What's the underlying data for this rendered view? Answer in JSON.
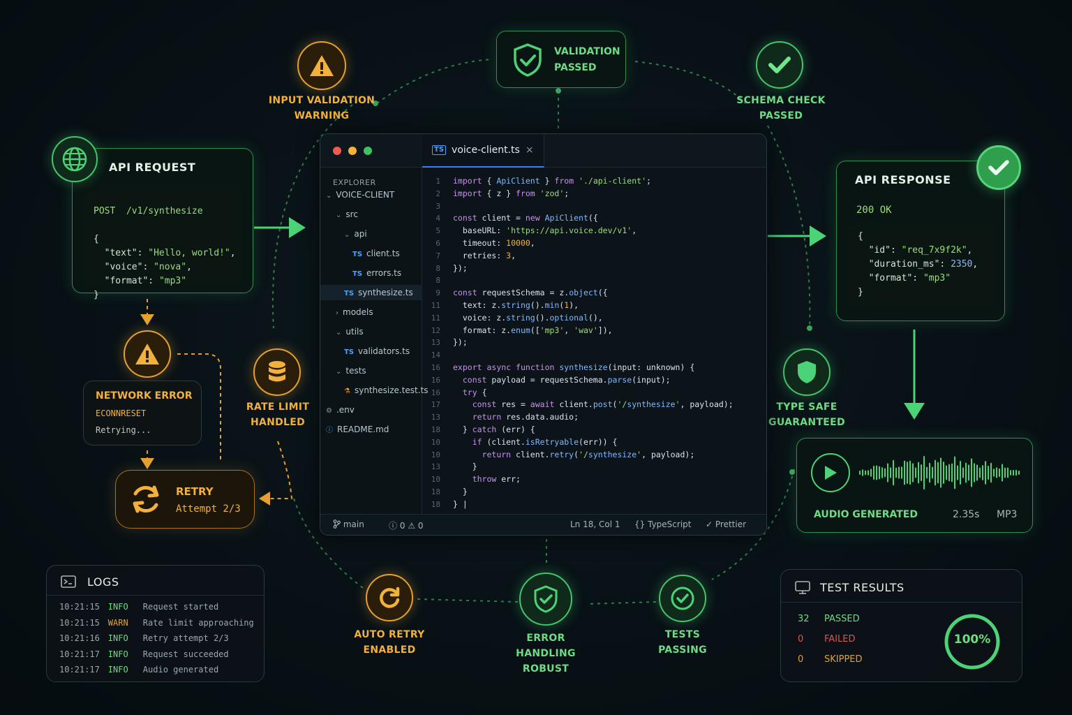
{
  "colors": {
    "green": "#45c46a",
    "orange": "#e5a12e",
    "red": "#e05252",
    "blue": "#4aa3ff"
  },
  "input_warning": {
    "icon": "warning-icon",
    "caption": "INPUT VALIDATION\nWARNING"
  },
  "validation": {
    "icon": "shield-check-icon",
    "label": "VALIDATION\nPASSED"
  },
  "schema": {
    "icon": "check-icon",
    "caption": "SCHEMA CHECK\nPASSED"
  },
  "api_request": {
    "icon": "globe-icon",
    "title": "API REQUEST",
    "method": "POST",
    "path": "/v1/synthesize",
    "body_open": "{",
    "lines": [
      {
        "key": "\"text\"",
        "value": "\"Hello, world!\"",
        "end": ","
      },
      {
        "key": "\"voice\"",
        "value": "\"nova\"",
        "end": ","
      },
      {
        "key": "\"format\"",
        "value": "\"mp3\"",
        "end": ""
      }
    ],
    "body_close": "}"
  },
  "api_response": {
    "icon": "check-icon",
    "title": "API RESPONSE",
    "status_code": "200",
    "status_text": "OK",
    "body_open": "{",
    "lines": [
      {
        "key": "\"id\"",
        "value": "\"req_7x9f2k\"",
        "end": ",",
        "kind": "str"
      },
      {
        "key": "\"duration_ms\"",
        "value": "2350",
        "end": ",",
        "kind": "num"
      },
      {
        "key": "\"format\"",
        "value": "\"mp3\"",
        "end": "",
        "kind": "str"
      }
    ],
    "body_close": "}"
  },
  "network_error": {
    "icon": "warning-icon",
    "title": "NETWORK ERROR",
    "code": "ECONNRESET",
    "status": "Retrying..."
  },
  "rate_limit": {
    "icon": "database-icon",
    "caption": "RATE LIMIT\nHANDLED"
  },
  "retry": {
    "icon": "refresh-icon",
    "title": "RETRY",
    "attempt": "Attempt 2/3"
  },
  "type_safe": {
    "icon": "shield-icon",
    "caption": "TYPE SAFE\nGUARANTEED"
  },
  "audio": {
    "icon": "play-icon",
    "label": "AUDIO GENERATED",
    "duration": "2.35s",
    "format": "MP3"
  },
  "auto_retry": {
    "icon": "refresh-icon",
    "caption": "AUTO RETRY\nENABLED"
  },
  "error_handling": {
    "icon": "shield-check-icon",
    "caption": "ERROR HANDLING\nROBUST"
  },
  "tests_passing": {
    "icon": "check-icon",
    "caption": "TESTS\nPASSING"
  },
  "logs": {
    "icon": "terminal-icon",
    "title": "LOGS",
    "rows": [
      {
        "time": "10:21:15",
        "level": "INFO",
        "message": "Request started"
      },
      {
        "time": "10:21:15",
        "level": "WARN",
        "message": "Rate limit approaching"
      },
      {
        "time": "10:21:16",
        "level": "INFO",
        "message": "Retry attempt 2/3"
      },
      {
        "time": "10:21:17",
        "level": "INFO",
        "message": "Request succeeded"
      },
      {
        "time": "10:21:17",
        "level": "INFO",
        "message": "Audio generated"
      }
    ]
  },
  "test_results": {
    "icon": "monitor-icon",
    "title": "TEST RESULTS",
    "passed_count": "32",
    "passed_label": "PASSED",
    "failed_count": "0",
    "failed_label": "FAILED",
    "skipped_count": "0",
    "skipped_label": "SKIPPED",
    "percent": "100%",
    "pass_fraction": 1.0
  },
  "editor": {
    "tab": "voice-client.ts",
    "tab_badge": "TS",
    "close": "×",
    "explorer_title": "EXPLORER",
    "tree": [
      {
        "label": "VOICE-CLIENT",
        "type": "folder-open",
        "depth": 0
      },
      {
        "label": "src",
        "type": "folder-open",
        "depth": 1
      },
      {
        "label": "api",
        "type": "folder-open",
        "depth": 2
      },
      {
        "label": "client.ts",
        "type": "ts",
        "depth": 3
      },
      {
        "label": "errors.ts",
        "type": "ts",
        "depth": 3
      },
      {
        "label": "synthesize.ts",
        "type": "ts",
        "depth": 2,
        "selected": true
      },
      {
        "label": "models",
        "type": "folder",
        "depth": 1
      },
      {
        "label": "utils",
        "type": "folder-open",
        "depth": 1
      },
      {
        "label": "validators.ts",
        "type": "ts",
        "depth": 2
      },
      {
        "label": "tests",
        "type": "folder-open",
        "depth": 1
      },
      {
        "label": "synthesize.test.ts",
        "type": "test",
        "depth": 2
      },
      {
        "label": ".env",
        "type": "gear",
        "depth": 0
      },
      {
        "label": "README.md",
        "type": "info",
        "depth": 0
      }
    ],
    "code": [
      {
        "n": "1",
        "t": "import { ApiClient } from './api-client';"
      },
      {
        "n": "2",
        "t": "import { z } from 'zod';"
      },
      {
        "n": "3",
        "t": ""
      },
      {
        "n": "4",
        "t": "const client = new ApiClient({"
      },
      {
        "n": "5",
        "t": "  baseURL: 'https://api.voice.dev/v1',"
      },
      {
        "n": "6",
        "t": "  timeout: 10000,"
      },
      {
        "n": "7",
        "t": "  retries: 3,"
      },
      {
        "n": "8",
        "t": "});"
      },
      {
        "n": "8",
        "t": ""
      },
      {
        "n": "9",
        "t": "const requestSchema = z.object({"
      },
      {
        "n": "11",
        "t": "  text: z.string().min(1),"
      },
      {
        "n": "11",
        "t": "  voice: z.string().optional(),"
      },
      {
        "n": "12",
        "t": "  format: z.enum(['mp3', 'wav']),"
      },
      {
        "n": "13",
        "t": "});"
      },
      {
        "n": "14",
        "t": ""
      },
      {
        "n": "16",
        "t": "export async function synthesize(input: unknown) {"
      },
      {
        "n": "16",
        "t": "  const payload = requestSchema.parse(input);"
      },
      {
        "n": "16",
        "t": "  try {"
      },
      {
        "n": "17",
        "t": "    const res = await client.post('/synthesize', payload);"
      },
      {
        "n": "13",
        "t": "    return res.data.audio;"
      },
      {
        "n": "18",
        "t": "  } catch (err) {"
      },
      {
        "n": "10",
        "t": "    if (client.isRetryable(err)) {"
      },
      {
        "n": "10",
        "t": "      return client.retry('/synthesize', payload);"
      },
      {
        "n": "13",
        "t": "    }"
      },
      {
        "n": "10",
        "t": "    throw err;"
      },
      {
        "n": "18",
        "t": "  }"
      },
      {
        "n": "18",
        "t": "} |"
      }
    ],
    "status": {
      "branch": "main",
      "errors": "0",
      "warnings": "0",
      "position": "Ln 18, Col 1",
      "language": "TypeScript",
      "formatter": "Prettier"
    }
  }
}
